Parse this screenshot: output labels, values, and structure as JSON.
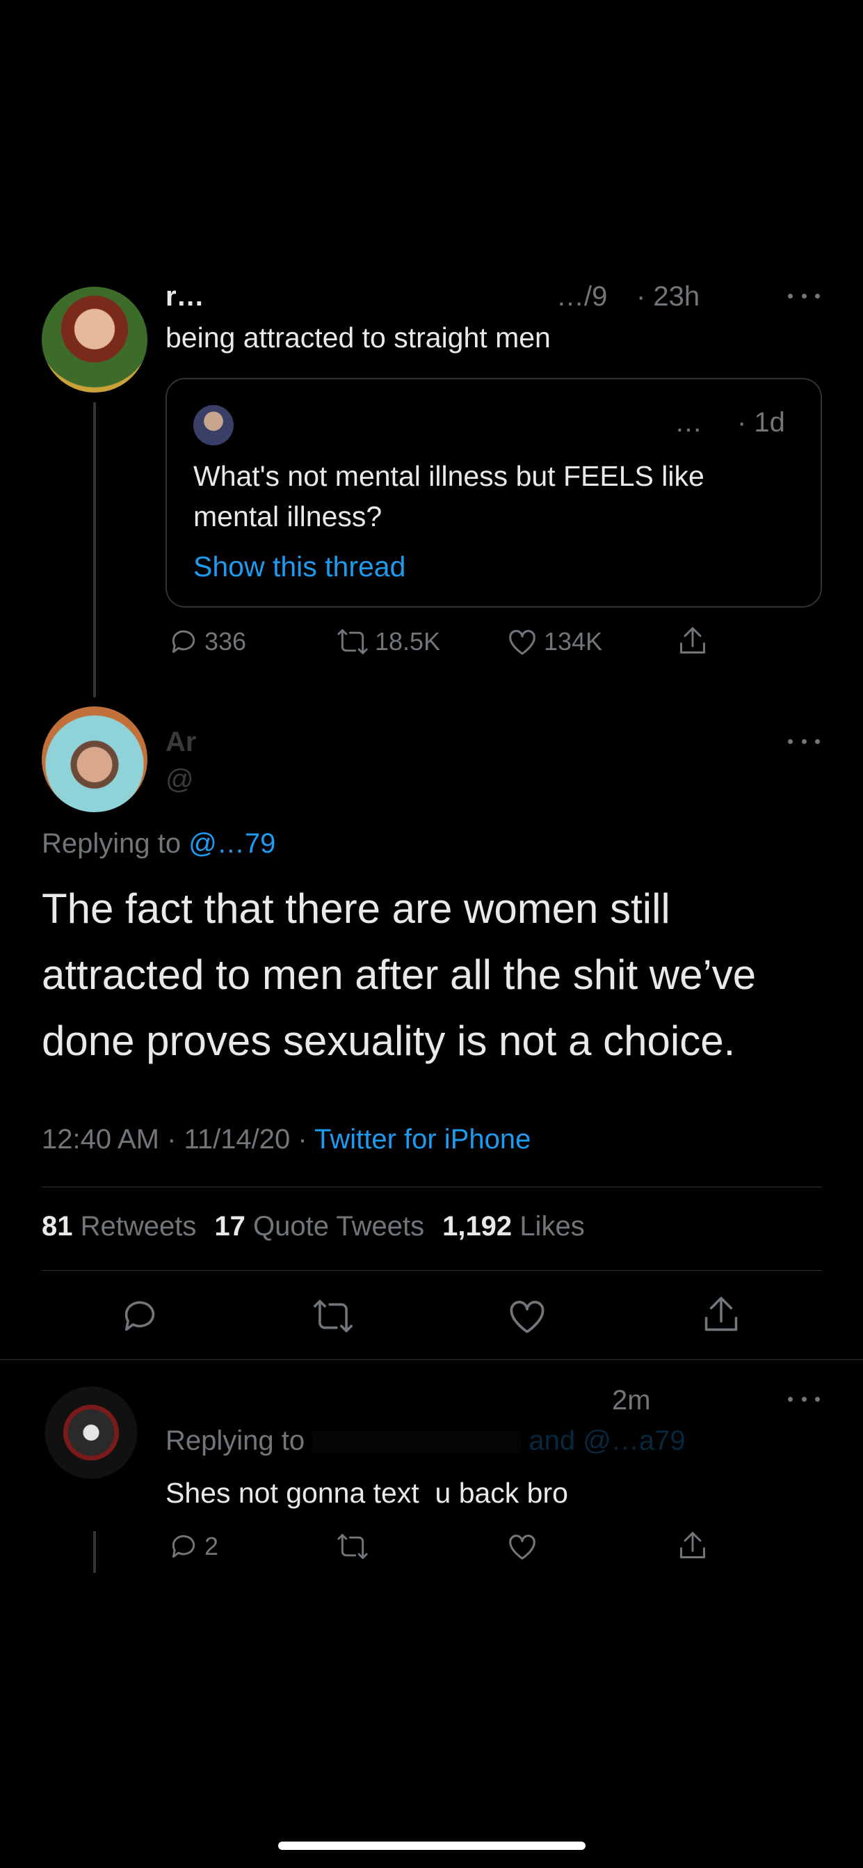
{
  "tweet1": {
    "name_partial": "r…",
    "handle_partial": "…/9",
    "time": "· 23h",
    "text": "being attracted to straight men",
    "quote": {
      "handle_partial": "…",
      "time": "· 1d",
      "text": "What's not mental illness but FEELS like mental illness?",
      "show_thread": "Show this thread"
    },
    "stats": {
      "replies": "336",
      "retweets": "18.5K",
      "likes": "134K"
    }
  },
  "main_tweet": {
    "name_partial": "Ar",
    "handle_partial": "@",
    "replying_label": "Replying to",
    "replying_handle_partial": "@…79",
    "text": "The fact that there are women still attracted to men after all the shit we’ve done proves sexuality is not a choice.",
    "timestamp": "12:40 AM · 11/14/20 ·",
    "source": "Twitter for iPhone",
    "retweets_count": "81",
    "retweets_label": "Retweets",
    "quotes_count": "17",
    "quotes_label": "Quote Tweets",
    "likes_count": "1,192",
    "likes_label": "Likes"
  },
  "reply": {
    "time": "2m",
    "replying_label": "Replying to",
    "replying_rest": "and @…a79",
    "text": "Shes not gonna text  u back bro",
    "stats": {
      "replies": "2"
    }
  },
  "colors": {
    "background": "#000000",
    "text": "#e7e9ea",
    "muted": "#71767b",
    "link": "#1d9bf0",
    "divider": "#2f3336"
  }
}
